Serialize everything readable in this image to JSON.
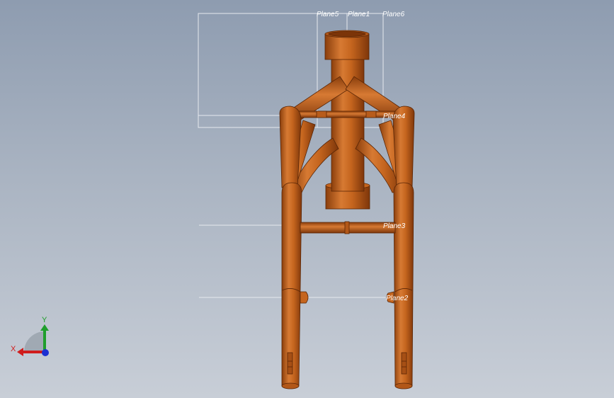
{
  "viewport": {
    "colors": {
      "tube": "#c5651e",
      "tube_dark": "#8a3e0c",
      "tube_light": "#e08a45",
      "plane_line": "#e6e9ee"
    }
  },
  "planes": {
    "plane5": "Plane5",
    "plane1": "Plane1",
    "plane6": "Plane6",
    "plane4": "Plane4",
    "plane3": "Plane3",
    "plane2": "Plane2"
  },
  "triad": {
    "x_label": "X",
    "y_label": "Y",
    "x_color": "#d01c1c",
    "y_color": "#1f9e2c",
    "z_color": "#1b2fd1"
  }
}
